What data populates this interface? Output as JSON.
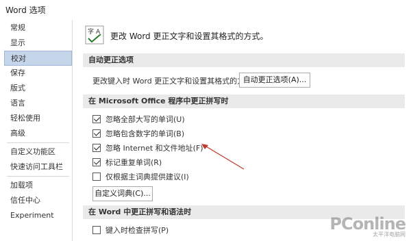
{
  "window": {
    "title": "Word 选项"
  },
  "sidebar": {
    "items": [
      {
        "label": "常规"
      },
      {
        "label": "显示"
      },
      {
        "label": "校对",
        "active": true
      },
      {
        "label": "保存"
      },
      {
        "label": "版式"
      },
      {
        "label": "语言"
      },
      {
        "label": "轻松使用"
      },
      {
        "label": "高级"
      },
      {
        "label": "自定义功能区"
      },
      {
        "label": "快速访问工具栏"
      },
      {
        "label": "加载项"
      },
      {
        "label": "信任中心"
      },
      {
        "label": "Experiment"
      }
    ]
  },
  "header": {
    "text": "更改 Word 更正文字和设置其格式的方式。",
    "icon": "abc-proofing-icon"
  },
  "autocorrect": {
    "section_title": "自动更正选项",
    "row_text": "更改键入时 Word 更正文字和设置其格式的方式:",
    "button_label": "自动更正选项(A)..."
  },
  "office_spelling": {
    "section_title": "在 Microsoft Office 程序中更正拼写时",
    "options": [
      {
        "label": "忽略全部大写的单词(U)",
        "checked": true
      },
      {
        "label": "忽略包含数字的单词(B)",
        "checked": true
      },
      {
        "label": "忽略 Internet 和文件地址(F)",
        "checked": true
      },
      {
        "label": "标记重复单词(R)",
        "checked": true
      },
      {
        "label": "仅根据主词典提供建议(I)",
        "checked": false
      }
    ],
    "dictionary_button": "自定义词典(C)..."
  },
  "word_spelling": {
    "section_title": "在 Word 中更正拼写和语法时",
    "options": [
      {
        "label": "键入时检查拼写(P)",
        "checked": false
      }
    ]
  },
  "watermark": {
    "logo": "PConline",
    "sub": "太平洋电脑网"
  },
  "colors": {
    "active_nav": "#c5d5ea",
    "section_bg": "#eaeaea",
    "arrow": "#c0392b"
  }
}
